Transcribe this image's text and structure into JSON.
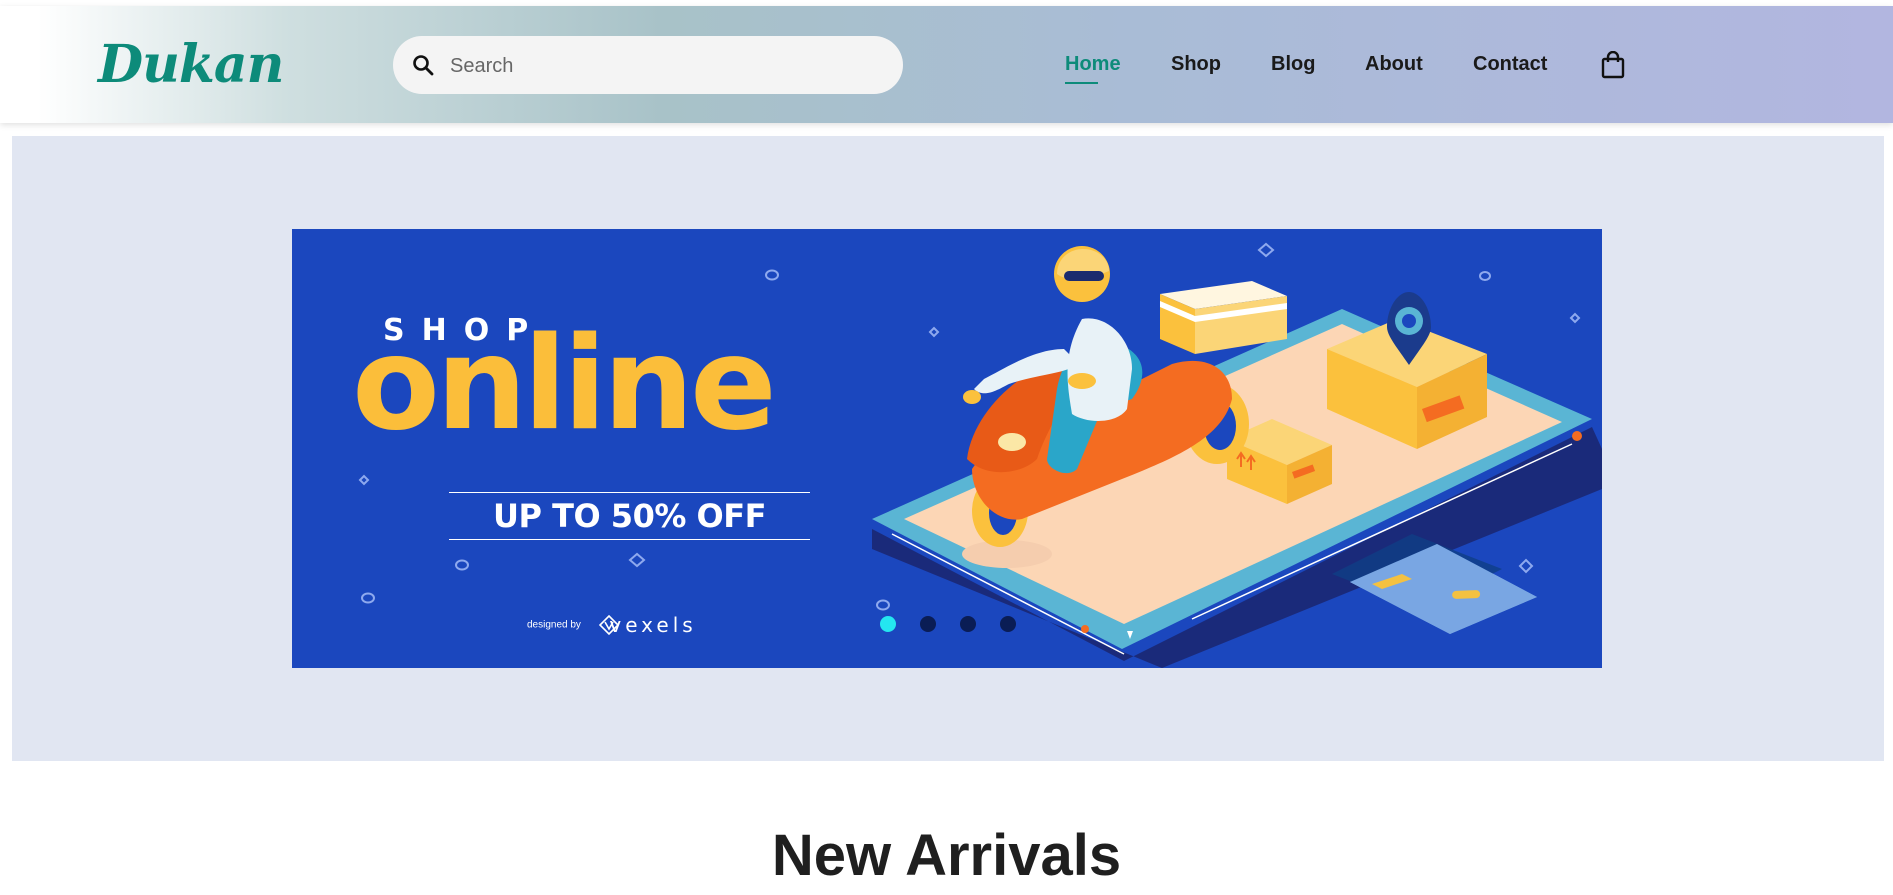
{
  "header": {
    "logo_text": "Dukan",
    "search": {
      "placeholder": "Search",
      "icon": "search-icon"
    },
    "nav": [
      {
        "label": "Home",
        "active": true
      },
      {
        "label": "Shop",
        "active": false
      },
      {
        "label": "Blog",
        "active": false
      },
      {
        "label": "About",
        "active": false
      },
      {
        "label": "Contact",
        "active": false
      }
    ],
    "cart_icon": "shopping-bag-icon"
  },
  "hero": {
    "banner": {
      "headline_small": "SHOP",
      "headline_big": "online",
      "promo": "UP TO 50% OFF",
      "credit_prefix": "designed by",
      "credit_brand": "vexels"
    },
    "carousel": {
      "count": 4,
      "active_index": 0
    }
  },
  "main": {
    "section_title": "New Arrivals"
  },
  "colors": {
    "brand": "#0d8b7a",
    "banner_bg": "#1b47be",
    "accent_yellow": "#fbbe3a",
    "dot_active": "#24e6f0",
    "dot_inactive": "#0a1d55",
    "hero_bg": "#e1e6f2"
  }
}
